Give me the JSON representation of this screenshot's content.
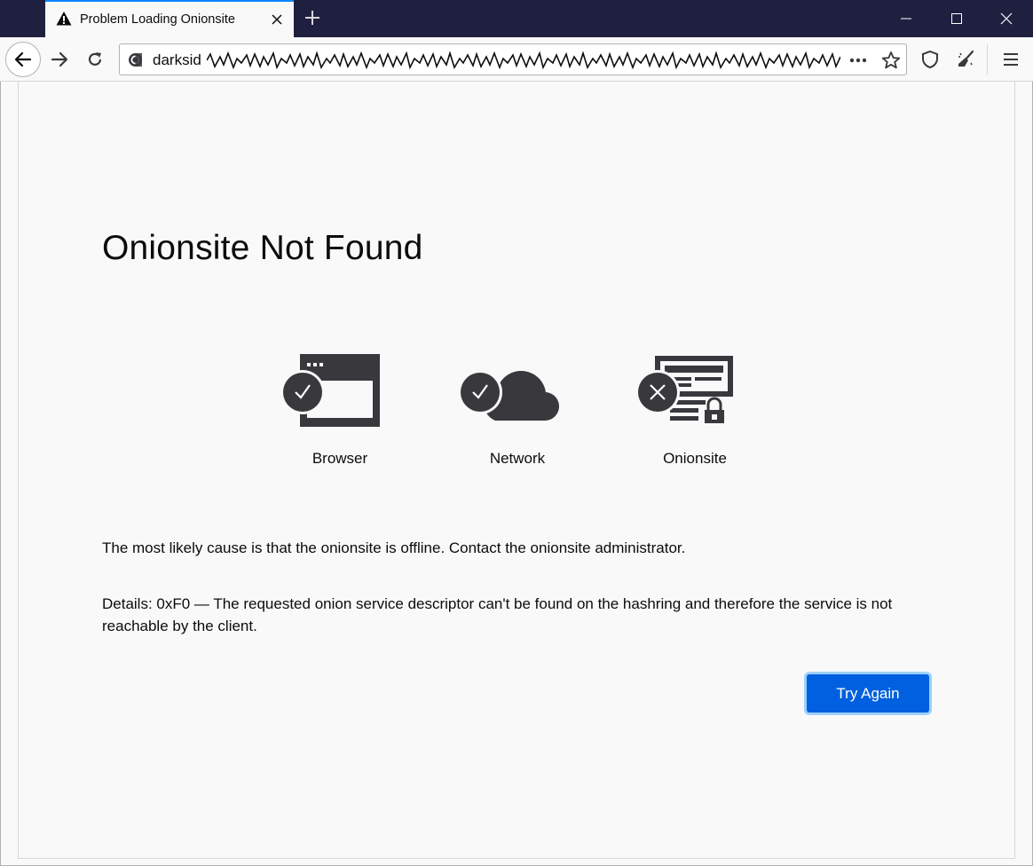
{
  "tab": {
    "title": "Problem Loading Onionsite",
    "icon": "warning-icon"
  },
  "window": {
    "buttons": [
      "minimize-icon",
      "maximize-icon",
      "close-icon"
    ]
  },
  "toolbar": {
    "url_prefix": "darksid",
    "url_redacted": true
  },
  "page": {
    "title": "Onionsite Not Found",
    "status": [
      {
        "label": "Browser",
        "state": "ok",
        "icon": "browser-icon"
      },
      {
        "label": "Network",
        "state": "ok",
        "icon": "cloud-icon"
      },
      {
        "label": "Onionsite",
        "state": "error",
        "icon": "onionsite-server-icon"
      }
    ],
    "cause": "The most likely cause is that the onionsite is offline. Contact the onionsite administrator.",
    "details": "Details: 0xF0 — The requested onion service descriptor can't be found on the hashring and therefore the service is not reachable by the client.",
    "try_again_label": "Try Again"
  },
  "colors": {
    "tabbar_bg": "#1f2040",
    "accent": "#0a84ff",
    "button_primary": "#0060df",
    "icon_dark": "#38383d"
  }
}
